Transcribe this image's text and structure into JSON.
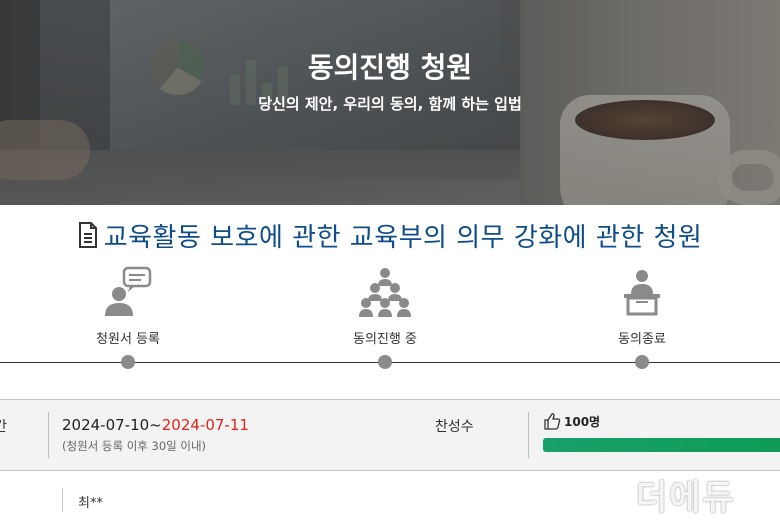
{
  "hero": {
    "title": "동의진행 청원",
    "subtitle": "당신의 제안, 우리의 동의, 함께 하는 입법"
  },
  "petition": {
    "title": "교육활동 보호에 관한 교육부의 의무 강화에 관한 청원",
    "title_color": "#0f4c8a"
  },
  "steps": [
    {
      "label": "청원서 등록",
      "icon": "speech-bubble-person-icon"
    },
    {
      "label": "동의진행 중",
      "icon": "group-people-icon"
    },
    {
      "label": "동의종료",
      "icon": "person-at-podium-icon"
    }
  ],
  "info": {
    "period_label_cut": "간",
    "date_start": "2024-07-10~",
    "date_end": "2024-07-11",
    "period_note": "(청원서 등록 이후 30일 이내)",
    "agree_label": "찬성수",
    "agree_count": "100명",
    "progress_fraction": 1.0,
    "progress_color": "#119c5c",
    "end_date_color": "#e3241b"
  },
  "author": {
    "name": "최**"
  },
  "watermark": {
    "text": "더에듀"
  }
}
